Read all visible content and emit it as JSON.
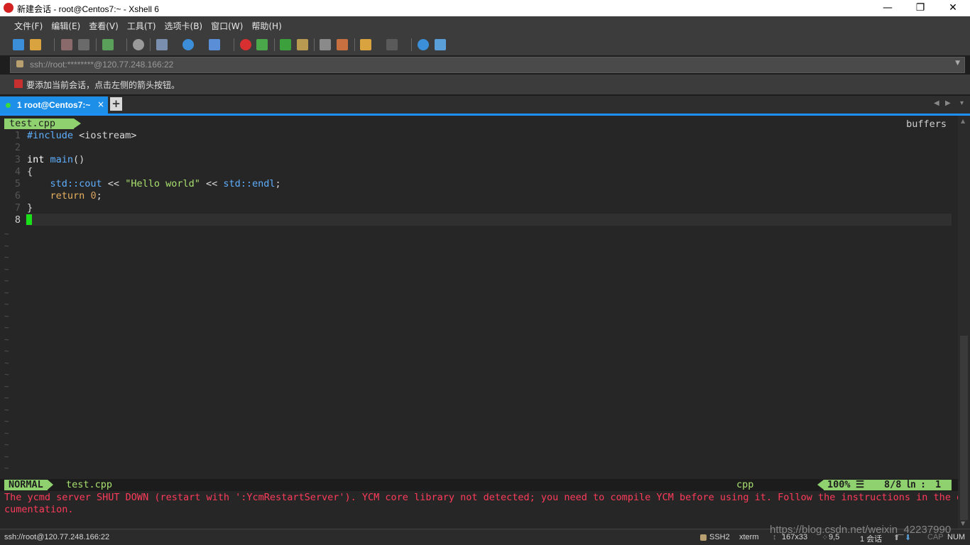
{
  "window": {
    "title": "新建会话 - root@Centos7:~ - Xshell 6"
  },
  "menu": [
    "文件(F)",
    "编辑(E)",
    "查看(V)",
    "工具(T)",
    "选项卡(B)",
    "窗口(W)",
    "帮助(H)"
  ],
  "address": {
    "value": "ssh://root:********@120.77.248.166:22"
  },
  "hint": "要添加当前会话，点击左侧的箭头按钮。",
  "tabs": {
    "active": {
      "label": "1 root@Centos7:~"
    },
    "add": "+",
    "close": "×"
  },
  "vim": {
    "file_tab": "test.cpp",
    "buffers": "buffers",
    "lines": [
      {
        "n": "1",
        "tokens": [
          [
            "pp",
            "#include"
          ],
          [
            "plain",
            " <iostream>"
          ]
        ]
      },
      {
        "n": "2",
        "tokens": []
      },
      {
        "n": "3",
        "tokens": [
          [
            "kw",
            "int"
          ],
          [
            "plain",
            " "
          ],
          [
            "pp",
            "main"
          ],
          [
            "plain",
            "()"
          ]
        ]
      },
      {
        "n": "4",
        "tokens": [
          [
            "plain",
            "{"
          ]
        ]
      },
      {
        "n": "5",
        "tokens": [
          [
            "plain",
            "    "
          ],
          [
            "ns",
            "std::cout"
          ],
          [
            "plain",
            " << "
          ],
          [
            "str",
            "\"Hello world\""
          ],
          [
            "plain",
            " << "
          ],
          [
            "ns",
            "std::endl"
          ],
          [
            "plain",
            ";"
          ]
        ]
      },
      {
        "n": "6",
        "tokens": [
          [
            "plain",
            "    "
          ],
          [
            "ret",
            "return"
          ],
          [
            "plain",
            " "
          ],
          [
            "num",
            "0"
          ],
          [
            "plain",
            ";"
          ]
        ]
      },
      {
        "n": "7",
        "tokens": [
          [
            "plain",
            "}"
          ]
        ]
      },
      {
        "n": "8",
        "tokens": []
      }
    ],
    "tilde": "~",
    "status": {
      "mode": "NORMAL",
      "file": "test.cpp",
      "filetype": "cpp",
      "percent": "100%",
      "menu_glyph": "☰",
      "position": "8/8",
      "ln_glyph": "㏑",
      "colon": ":",
      "col": "1"
    },
    "error_line1": "The ycmd server SHUT DOWN (restart with ':YcmRestartServer'). YCM core library not detected; you need to compile YCM before using it. Follow the instructions in the do",
    "error_line2": "cumentation."
  },
  "statusbar": {
    "connection": "ssh://root@120.77.248.166:22",
    "protocol": "SSH2",
    "terminal": "xterm",
    "size": "167x33",
    "cursor": "9,5",
    "sessions": "1 会话",
    "cap": "CAP",
    "num": "NUM",
    "watermark": "https://blog.csdn.net/weixin_42237990"
  }
}
